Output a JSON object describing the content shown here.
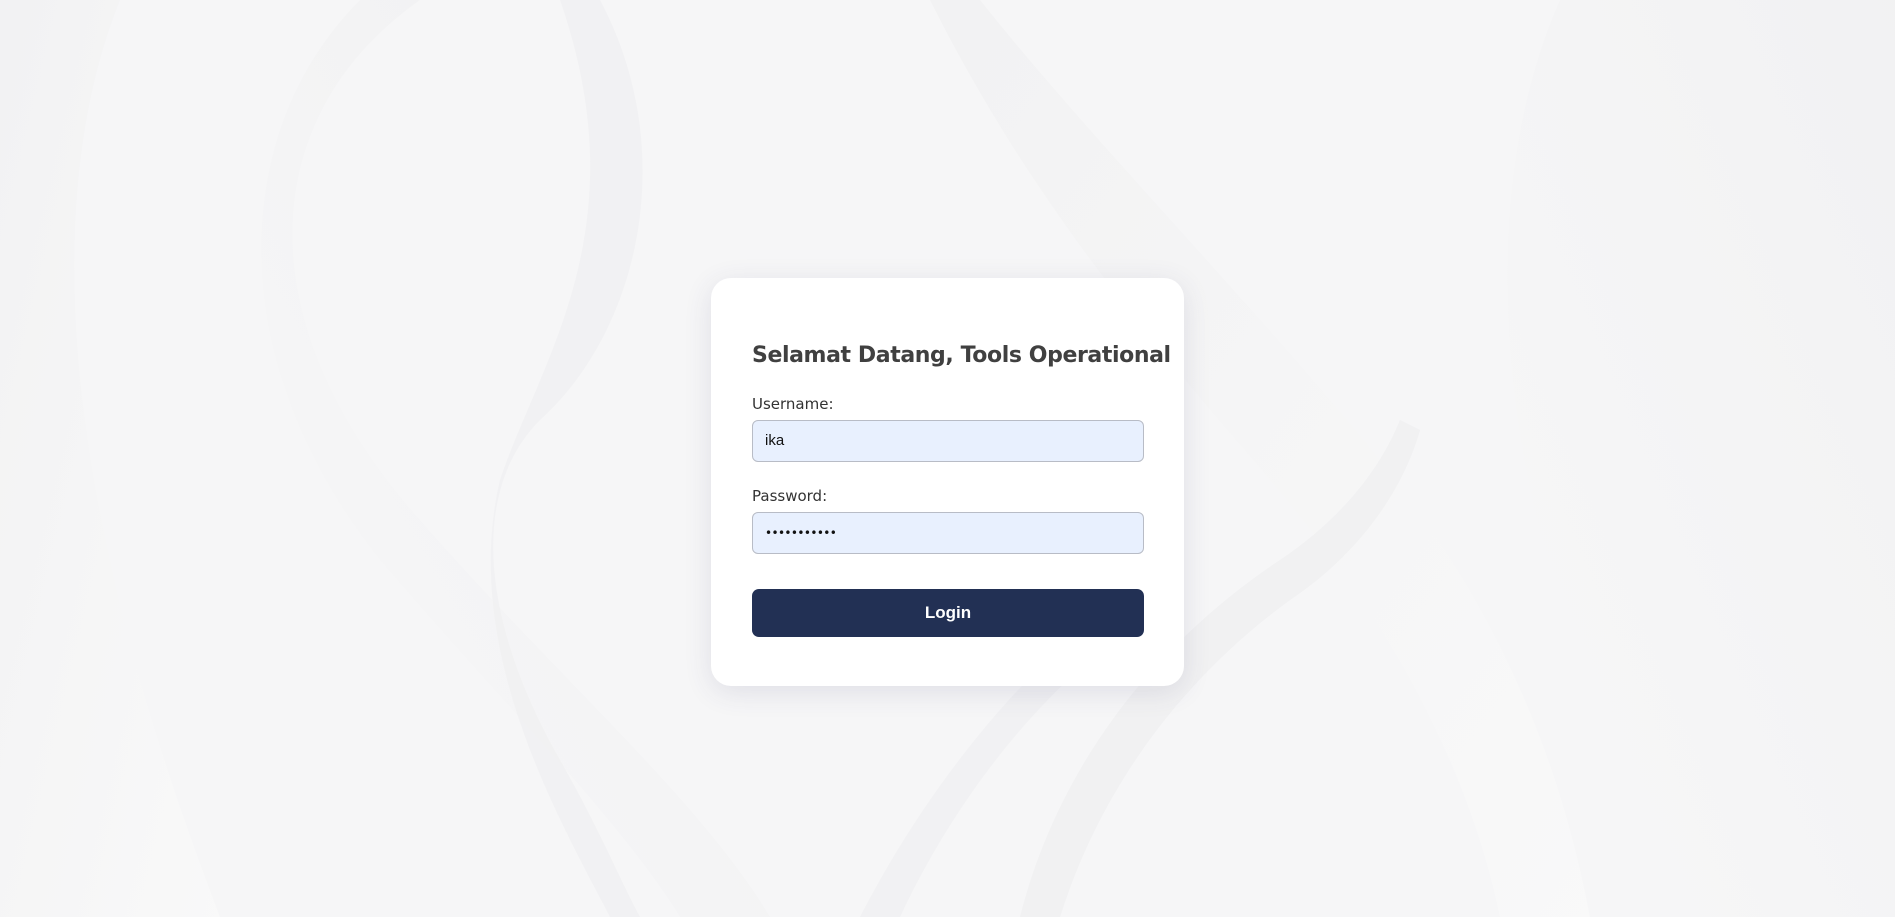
{
  "login": {
    "title": "Selamat Datang, Tools Operational",
    "username_label": "Username:",
    "username_value": "ika",
    "password_label": "Password:",
    "password_value": "•••••••••••",
    "login_button": "Login"
  },
  "colors": {
    "background": "#f5f5f6",
    "card": "#ffffff",
    "input_fill": "#e8f0fe",
    "button": "#223054",
    "title_text": "#404040"
  }
}
